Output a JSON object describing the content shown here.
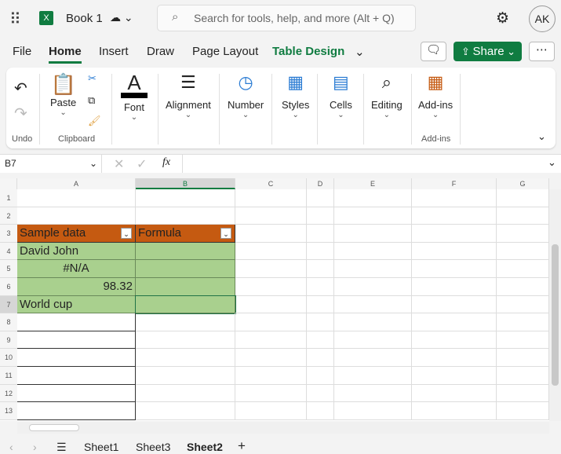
{
  "titlebar": {
    "app_icon": "excel-icon",
    "title": "Book 1",
    "search_placeholder": "Search for tools, help, and more (Alt + Q)",
    "avatar": "AK"
  },
  "menu": {
    "items": [
      "File",
      "Home",
      "Insert",
      "Draw",
      "Page Layout",
      "Table Design"
    ],
    "share": "Share"
  },
  "ribbon": {
    "undo_label": "Undo",
    "paste": "Paste",
    "clipboard_label": "Clipboard",
    "font": "Font",
    "alignment": "Alignment",
    "number": "Number",
    "styles": "Styles",
    "cells": "Cells",
    "editing": "Editing",
    "addins": "Add-ins",
    "addins_label": "Add-ins"
  },
  "formula_bar": {
    "name_box": "B7",
    "fx": "fx",
    "value": ""
  },
  "grid": {
    "columns": [
      "A",
      "B",
      "C",
      "D",
      "E",
      "F",
      "G"
    ],
    "rows": [
      "1",
      "2",
      "3",
      "4",
      "5",
      "6",
      "7",
      "8",
      "9",
      "10",
      "11",
      "12",
      "13"
    ],
    "header": [
      "Sample data",
      "Formula"
    ],
    "data": [
      [
        "David John",
        ""
      ],
      [
        "#N/A",
        ""
      ],
      [
        "98.32",
        ""
      ],
      [
        "World cup",
        ""
      ]
    ]
  },
  "sheets": {
    "tabs": [
      "Sheet1",
      "Sheet3",
      "Sheet2"
    ],
    "active": "Sheet2"
  },
  "colors": {
    "table_header": "#c55a11",
    "table_body": "#a9d08e",
    "brand": "#107c41"
  }
}
